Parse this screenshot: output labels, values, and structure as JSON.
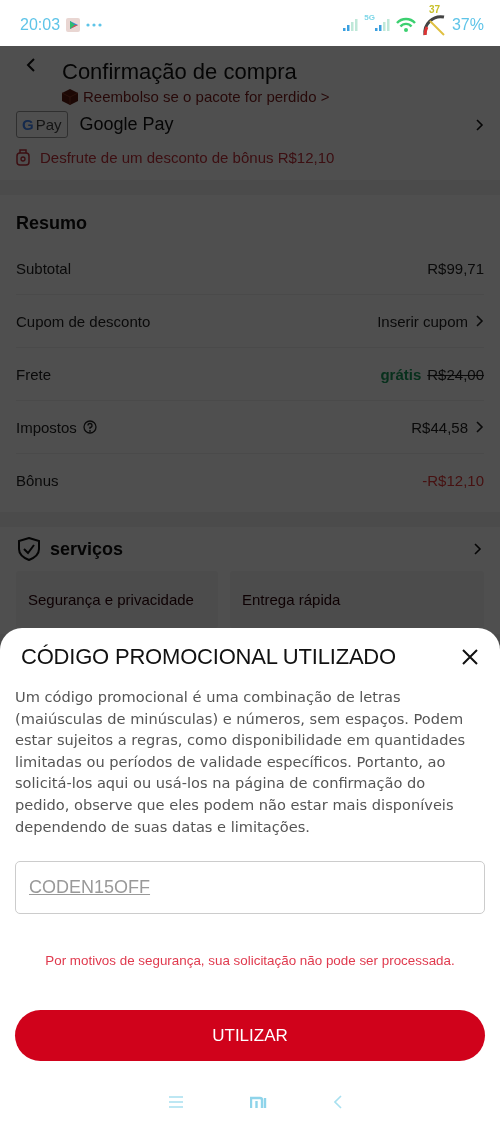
{
  "status_bar": {
    "time": "20:03",
    "network_label": "5G",
    "gauge_reading": "37",
    "battery": "37%"
  },
  "header": {
    "title": "Confirmação de compra",
    "subtitle": "Reembolso se o pacote for perdido >"
  },
  "payment": {
    "logo_letter": "G",
    "logo_text": "Pay",
    "method": "Google Pay",
    "bonus_notice": "Desfrute de um desconto de bônus R$12,10"
  },
  "summary": {
    "title": "Resumo",
    "rows": [
      {
        "kind": "plain",
        "label": "Subtotal",
        "value": "R$99,71"
      },
      {
        "kind": "link",
        "label": "Cupom de desconto",
        "value": "Inserir cupom"
      },
      {
        "kind": "free",
        "label": "Frete",
        "badge": "grátis",
        "value": "R$24,00"
      },
      {
        "kind": "info",
        "label": "Impostos",
        "value": "R$44,58"
      },
      {
        "kind": "discount",
        "label": "Bônus",
        "value": "-R$12,10"
      }
    ]
  },
  "services": {
    "title": "serviços",
    "tiles": [
      "Segurança e privacidade",
      "Entrega rápida"
    ]
  },
  "modal": {
    "title": "CÓDIGO PROMOCIONAL UTILIZADO",
    "body": "Um código promocional é uma combinação de letras (maiúsculas de minúsculas) e números, sem espaços. Podem estar sujeitos a regras, como disponibilidade em quantidades limitadas ou períodos de validade específicos. Portanto, ao solicitá-los aqui ou usá-los na página de confirmação do pedido, observe que eles podem não estar mais disponíveis dependendo de suas datas e limitações.",
    "code": "CODEN15OFF",
    "error": "Por motivos de segurança, sua solicitação não pode ser processada.",
    "button": "UTILIZAR"
  }
}
